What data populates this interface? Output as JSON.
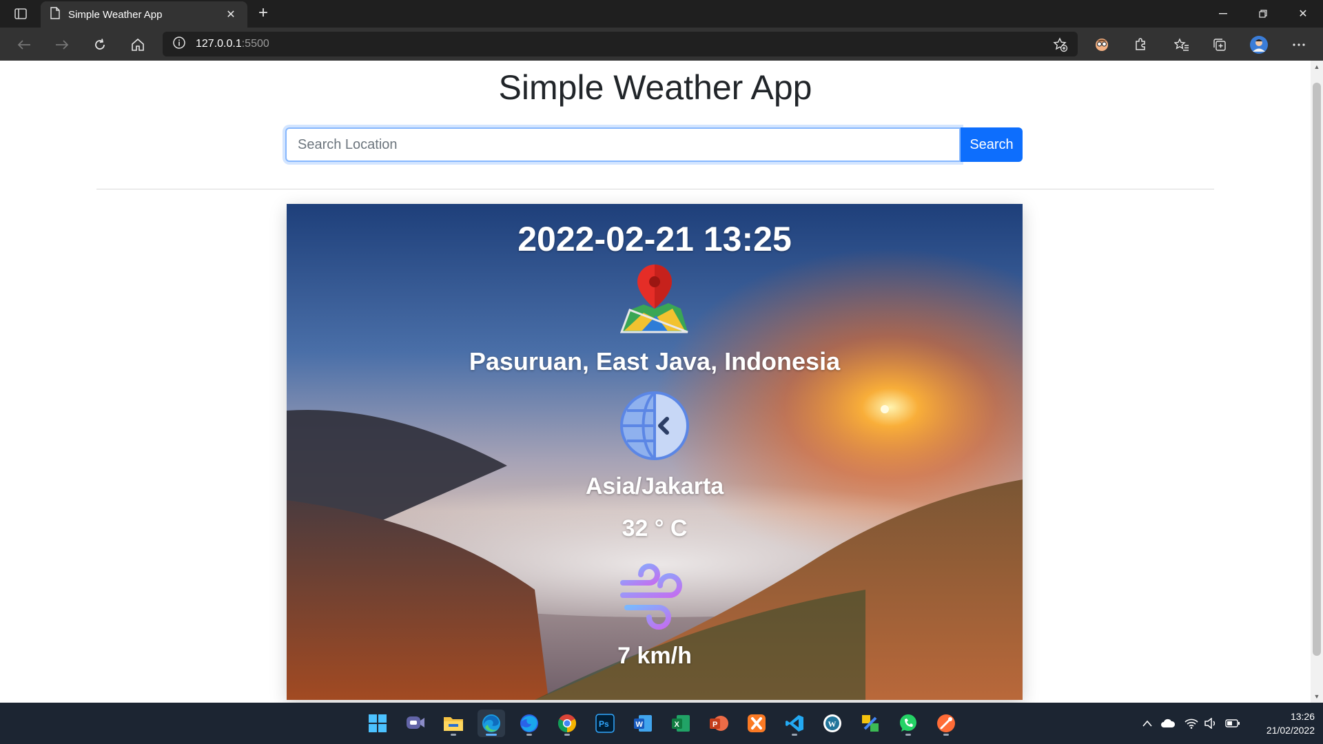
{
  "browser": {
    "tab_title": "Simple Weather App",
    "url_host": "127.0.0.1",
    "url_port": ":5500"
  },
  "page": {
    "title": "Simple Weather App",
    "search_placeholder": "Search Location",
    "search_button": "Search"
  },
  "weather": {
    "datetime": "2022-02-21 13:25",
    "location": "Pasuruan, East Java, Indonesia",
    "timezone": "Asia/Jakarta",
    "temperature": "32 ° C",
    "wind": "7 km/h",
    "icons": [
      "map-pin-icon",
      "globe-clock-icon",
      "wind-icon"
    ]
  },
  "taskbar": {
    "apps": [
      "start",
      "teams-chat",
      "file-explorer",
      "edge",
      "firefox",
      "chrome",
      "photoshop",
      "word",
      "excel",
      "powerpoint",
      "xampp",
      "vscode",
      "wordpress-local",
      "upwork",
      "whatsapp",
      "postman"
    ],
    "time": "13:26",
    "date": "21/02/2022"
  },
  "colors": {
    "accent": "#0d6efd",
    "taskbar": "#1c2532",
    "chrome": "#333333"
  }
}
